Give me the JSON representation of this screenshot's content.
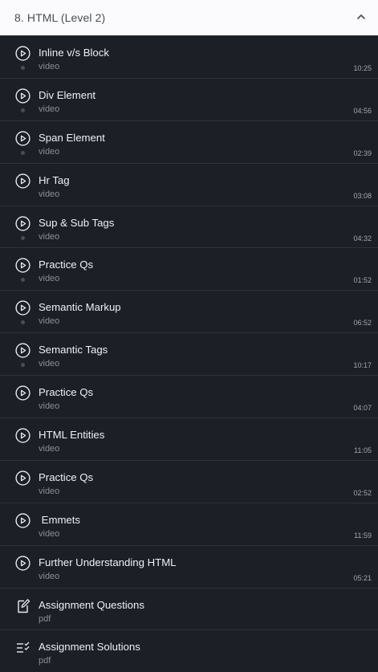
{
  "section": {
    "title": "8. HTML (Level 2)",
    "icon": "chevron-up-icon"
  },
  "colors": {
    "header_bg": "#fbfbfd",
    "list_bg": "#1d1f27",
    "divider": "#30323c"
  },
  "items": [
    {
      "title": "Inline v/s Block",
      "type": "video",
      "duration": "10:25",
      "icon": "play-circle-icon",
      "dot": true
    },
    {
      "title": "Div Element",
      "type": "video",
      "duration": "04:56",
      "icon": "play-circle-icon",
      "dot": true
    },
    {
      "title": "Span Element",
      "type": "video",
      "duration": "02:39",
      "icon": "play-circle-icon",
      "dot": true
    },
    {
      "title": "Hr Tag",
      "type": "video",
      "duration": "03:08",
      "icon": "play-circle-icon",
      "dot": false
    },
    {
      "title": "Sup & Sub Tags",
      "type": "video",
      "duration": "04:32",
      "icon": "play-circle-icon",
      "dot": true
    },
    {
      "title": "Practice Qs",
      "type": "video",
      "duration": "01:52",
      "icon": "play-circle-icon",
      "dot": true
    },
    {
      "title": "Semantic Markup",
      "type": "video",
      "duration": "06:52",
      "icon": "play-circle-icon",
      "dot": true
    },
    {
      "title": "Semantic Tags",
      "type": "video",
      "duration": "10:17",
      "icon": "play-circle-icon",
      "dot": true
    },
    {
      "title": "Practice Qs",
      "type": "video",
      "duration": "04:07",
      "icon": "play-circle-icon",
      "dot": false
    },
    {
      "title": "HTML Entities",
      "type": "video",
      "duration": "11:05",
      "icon": "play-circle-icon",
      "dot": false
    },
    {
      "title": "Practice Qs",
      "type": "video",
      "duration": "02:52",
      "icon": "play-circle-icon",
      "dot": false
    },
    {
      "title": " Emmets",
      "type": "video",
      "duration": "11:59",
      "icon": "play-circle-icon",
      "dot": false
    },
    {
      "title": "Further Understanding HTML",
      "type": "video",
      "duration": "05:21",
      "icon": "play-circle-icon",
      "dot": false
    },
    {
      "title": "Assignment Questions",
      "type": "pdf",
      "duration": "",
      "icon": "edit-document-icon",
      "dot": false
    },
    {
      "title": "Assignment Solutions",
      "type": "pdf",
      "duration": "",
      "icon": "checklist-icon",
      "dot": false
    }
  ]
}
